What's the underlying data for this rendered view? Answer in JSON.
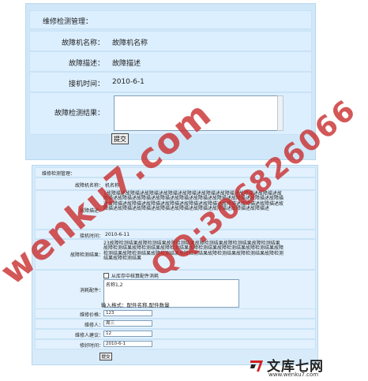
{
  "panel1": {
    "title": "维修检测管理：",
    "fault_name_label": "故障机名称：",
    "fault_name_value": "故障机名称",
    "fault_desc_label": "故障描述：",
    "fault_desc_value": "故障描述",
    "receive_time_label": "接机时间：",
    "receive_time_value": "2010-6-1",
    "result_label": "故障检测结果：",
    "result_value": "",
    "submit_label": "提交"
  },
  "panel2": {
    "title": "维修检测管理：",
    "fault_name_label": "故障机名称：",
    "fault_name_value": "机名称",
    "fault_desc_label": "故障描述：",
    "fault_desc_value": "1故障描述故障描述故障描述故障描述故障描述故障描述故障描述故障描述故障描述故障描述故障描述故障描述故障描述故障描述故障描述故障描述故障描述故障描述故障描述故障描述故障描述故障描述故障描述故障描述故障描述故障描述故障描述故障描述故障描述故障描述故障描述故障描述故障描述故障描述故障描述故障描述故障描述",
    "receive_time_label": "接机时间：",
    "receive_time_value": "2010-6-11",
    "result_label": "故障检测结果：",
    "result_value": "23故障检测结果故障检测结果故障检测结果故障检测结果故障检测结果故障检测结果故障检测结果故障检测结果故障检测结果故障检测结果故障检测结果故障检测结果故障检测结果故障检测结果故障检测结果故障检测结果故障检测结果故障检测结果故障检测结果故障检测结果",
    "parts_label": "消耗配件：",
    "stock_check_label": "从库存中核算配件消耗",
    "parts_value": "名称1,2",
    "input_hint": "输入格式：配件名称,配件数量",
    "price_label": "维修价格：",
    "price_value": "123",
    "repairer_label": "维修人：",
    "repairer_value": "周三",
    "suggestion_label": "维修人建议：",
    "suggestion_value": "12",
    "done_time_label": "修好时间：",
    "done_time_value": "2010-6-1",
    "submit_label": "提交"
  },
  "watermark": {
    "text1": "wenku7.com",
    "text2": "QQ:306826066",
    "brand_name": "文库七网",
    "brand_url": "www.wenku7.com",
    "color": "#c82828"
  }
}
